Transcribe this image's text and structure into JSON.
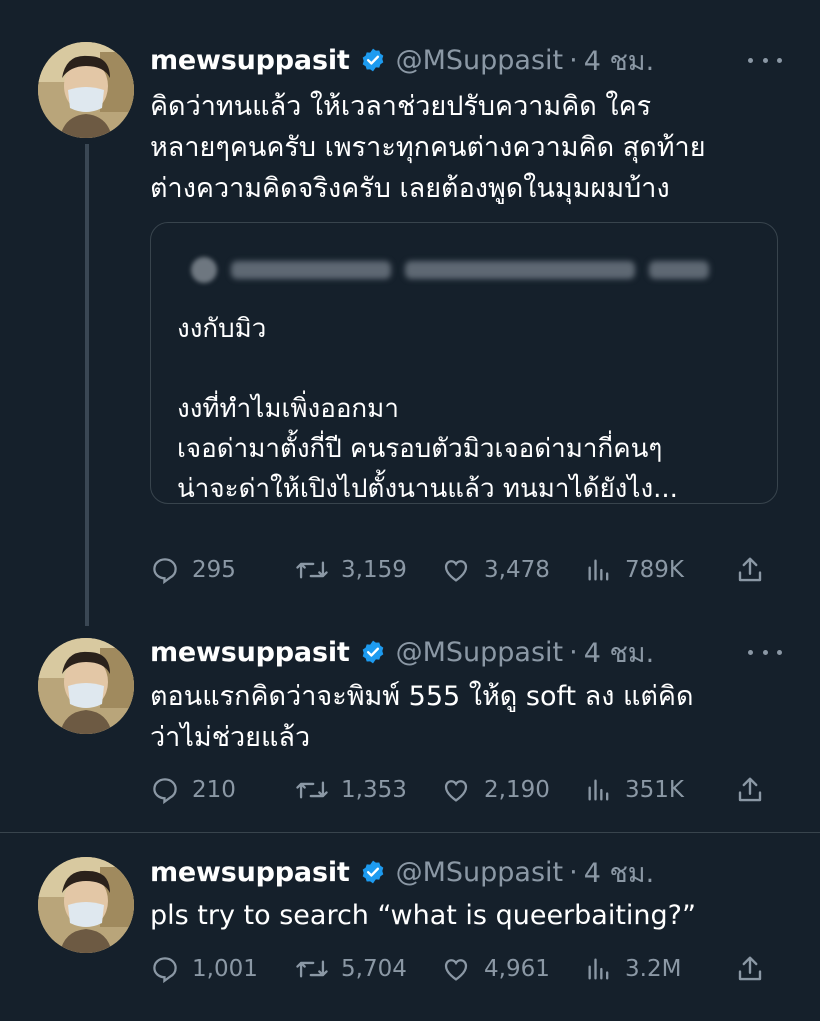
{
  "colors": {
    "background": "#15202b",
    "text": "#ffffff",
    "muted": "#8b98a5",
    "verified": "#1d9bf0",
    "border": "#38444d"
  },
  "tweets": [
    {
      "name": "mewsuppasit",
      "handle": "@MSuppasit",
      "separator": "·",
      "time": "4 ชม.",
      "text": "คิดว่าทนแล้ว ให้เวลาช่วยปรับความคิด ใคร\nหลายๆคนครับ เพราะทุกคนต่างความคิด สุดท้าย\nต่างความคิดจริงครับ เลยต้องพูดในมุมผมบ้าง",
      "quote": {
        "text": "งงกับมิว\n\nงงที่ทำไมเพิ่งออกมา\nเจอด่ามาตั้งกี่ปี คนรอบตัวมิวเจอด่ามากี่คนๆ\nน่าจะด่าให้เปิงไปตั้งนานแล้ว ทนมาได้ยังไง..."
      },
      "replies": "295",
      "retweets": "3,159",
      "likes": "3,478",
      "views": "789K"
    },
    {
      "name": "mewsuppasit",
      "handle": "@MSuppasit",
      "separator": "·",
      "time": "4 ชม.",
      "text": "ตอนแรกคิดว่าจะพิมพ์ 555 ให้ดู soft ลง แต่คิด\nว่าไม่ช่วยแล้ว",
      "replies": "210",
      "retweets": "1,353",
      "likes": "2,190",
      "views": "351K"
    },
    {
      "name": "mewsuppasit",
      "handle": "@MSuppasit",
      "separator": "·",
      "time": "4 ชม.",
      "text": "pls try to search “what is queerbaiting?”",
      "replies": "1,001",
      "retweets": "5,704",
      "likes": "4,961",
      "views": "3.2M"
    }
  ]
}
